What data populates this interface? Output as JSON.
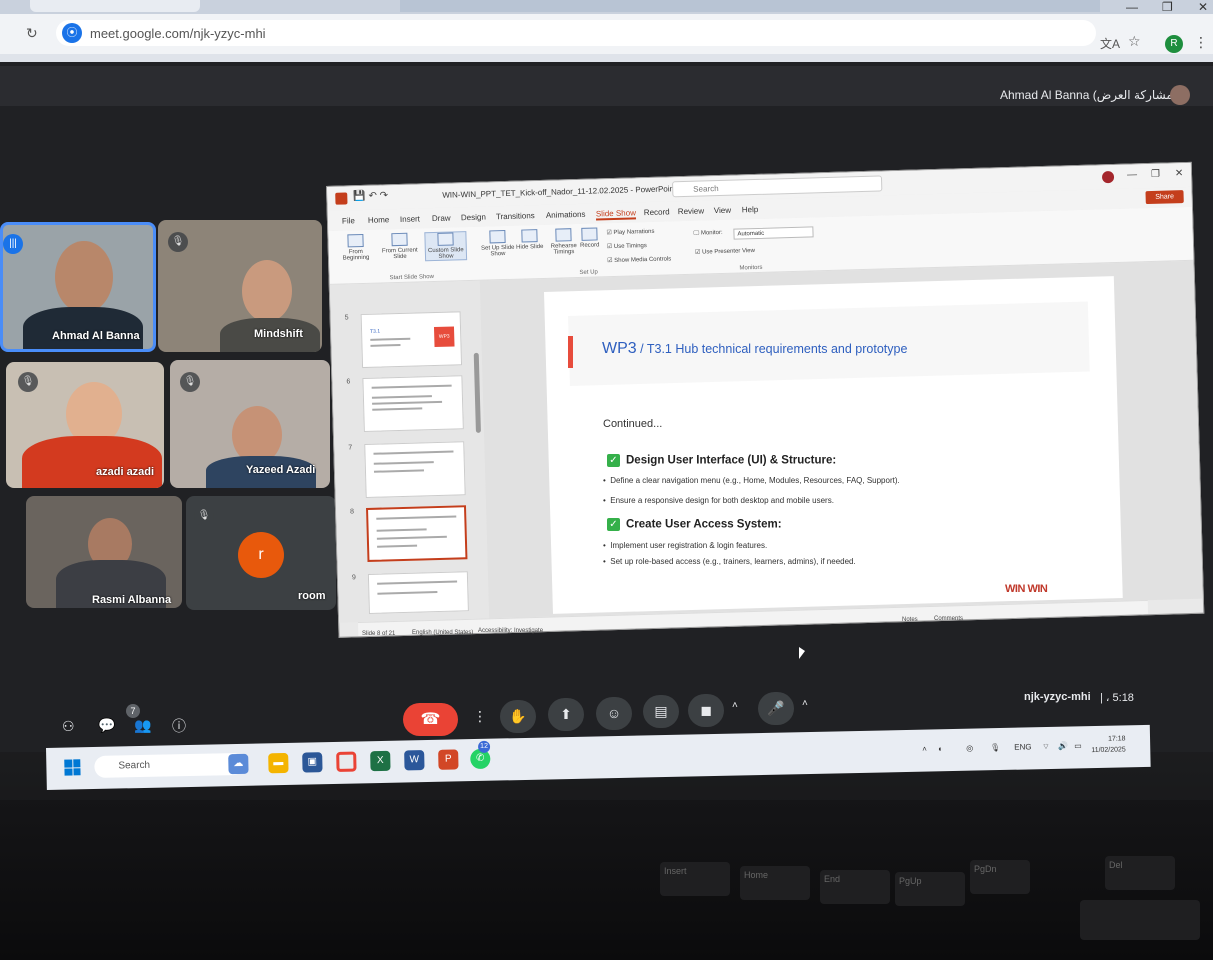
{
  "browser": {
    "url": "meet.google.com/njk-yzyc-mhi",
    "profile_initial": "R",
    "window_controls": [
      "—",
      "❐",
      "✕"
    ]
  },
  "meet": {
    "presenter_label": "Ahmad Al Banna (مشاركة العرض)",
    "participants": [
      {
        "name": "Ahmad Al Banna"
      },
      {
        "name": "Mindshift"
      },
      {
        "name": "azadi azadi"
      },
      {
        "name": "Yazeed Azadi"
      },
      {
        "name": "Rasmi Albanna"
      },
      {
        "name": "room",
        "initial": "r"
      }
    ],
    "meeting_code": "njk-yzyc-mhi",
    "meeting_time": "| ، 5:18",
    "people_count": "7",
    "colors": {
      "end_call": "#ea4335",
      "speaking": "#1a73e8",
      "room_avatar": "#e8590c"
    }
  },
  "powerpoint": {
    "filename": "WIN-WIN_PPT_TET_Kick-off_Nador_11-12.02.2025  -  PowerPoint",
    "search_placeholder": "Search",
    "share_label": "Share",
    "menu": [
      "File",
      "Home",
      "Insert",
      "Draw",
      "Design",
      "Transitions",
      "Animations",
      "Slide Show",
      "Record",
      "Review",
      "View",
      "Help"
    ],
    "active_menu": "Slide Show",
    "ribbon": {
      "from_beginning": "From Beginning",
      "from_current": "From Current Slide",
      "custom_show": "Custom Slide Show",
      "set_up": "Set Up Slide Show",
      "hide_slide": "Hide Slide",
      "rehearse": "Rehearse Timings",
      "record": "Record",
      "play_narrations": "Play Narrations",
      "use_timings": "Use Timings",
      "show_media_controls": "Show Media Controls",
      "monitor_label": "Monitor:",
      "monitor_value": "Automatic",
      "use_presenter_view": "Use Presenter View",
      "group_start": "Start Slide Show",
      "group_setup": "Set Up",
      "group_monitors": "Monitors"
    },
    "thumb_numbers": [
      "5",
      "6",
      "7",
      "8",
      "9"
    ],
    "thumb5_text": "T3.1",
    "thumb5_badge": "WP3",
    "slide": {
      "wp": "WP3",
      "title_rest": " / T3.1 Hub technical requirements and prototype",
      "continued": "Continued...",
      "section1": "Design User Interface (UI) & Structure:",
      "bullet1a": "Define a clear navigation menu (e.g., Home, Modules, Resources, FAQ, Support).",
      "bullet1b": "Ensure a responsive design for both desktop and mobile users.",
      "section2": "Create User Access System:",
      "bullet2a": "Implement user registration & login features.",
      "bullet2b": "Set up role-based access (e.g., trainers, learners, admins), if needed.",
      "logo": "WIN WIN"
    },
    "status": {
      "slide_of": "Slide 8 of 21",
      "language": "English (United States)",
      "accessibility": "Accessibility: Investigate",
      "notes": "Notes",
      "comments": "Comments"
    }
  },
  "taskbar": {
    "search_placeholder": "Search",
    "whatsapp_badge": "12",
    "lang": "ENG",
    "time": "17:18",
    "date": "11/02/2025"
  },
  "keyboard": {
    "keys": [
      "Insert",
      "Home",
      "End",
      "PgUp",
      "PgDn",
      "Del"
    ]
  }
}
